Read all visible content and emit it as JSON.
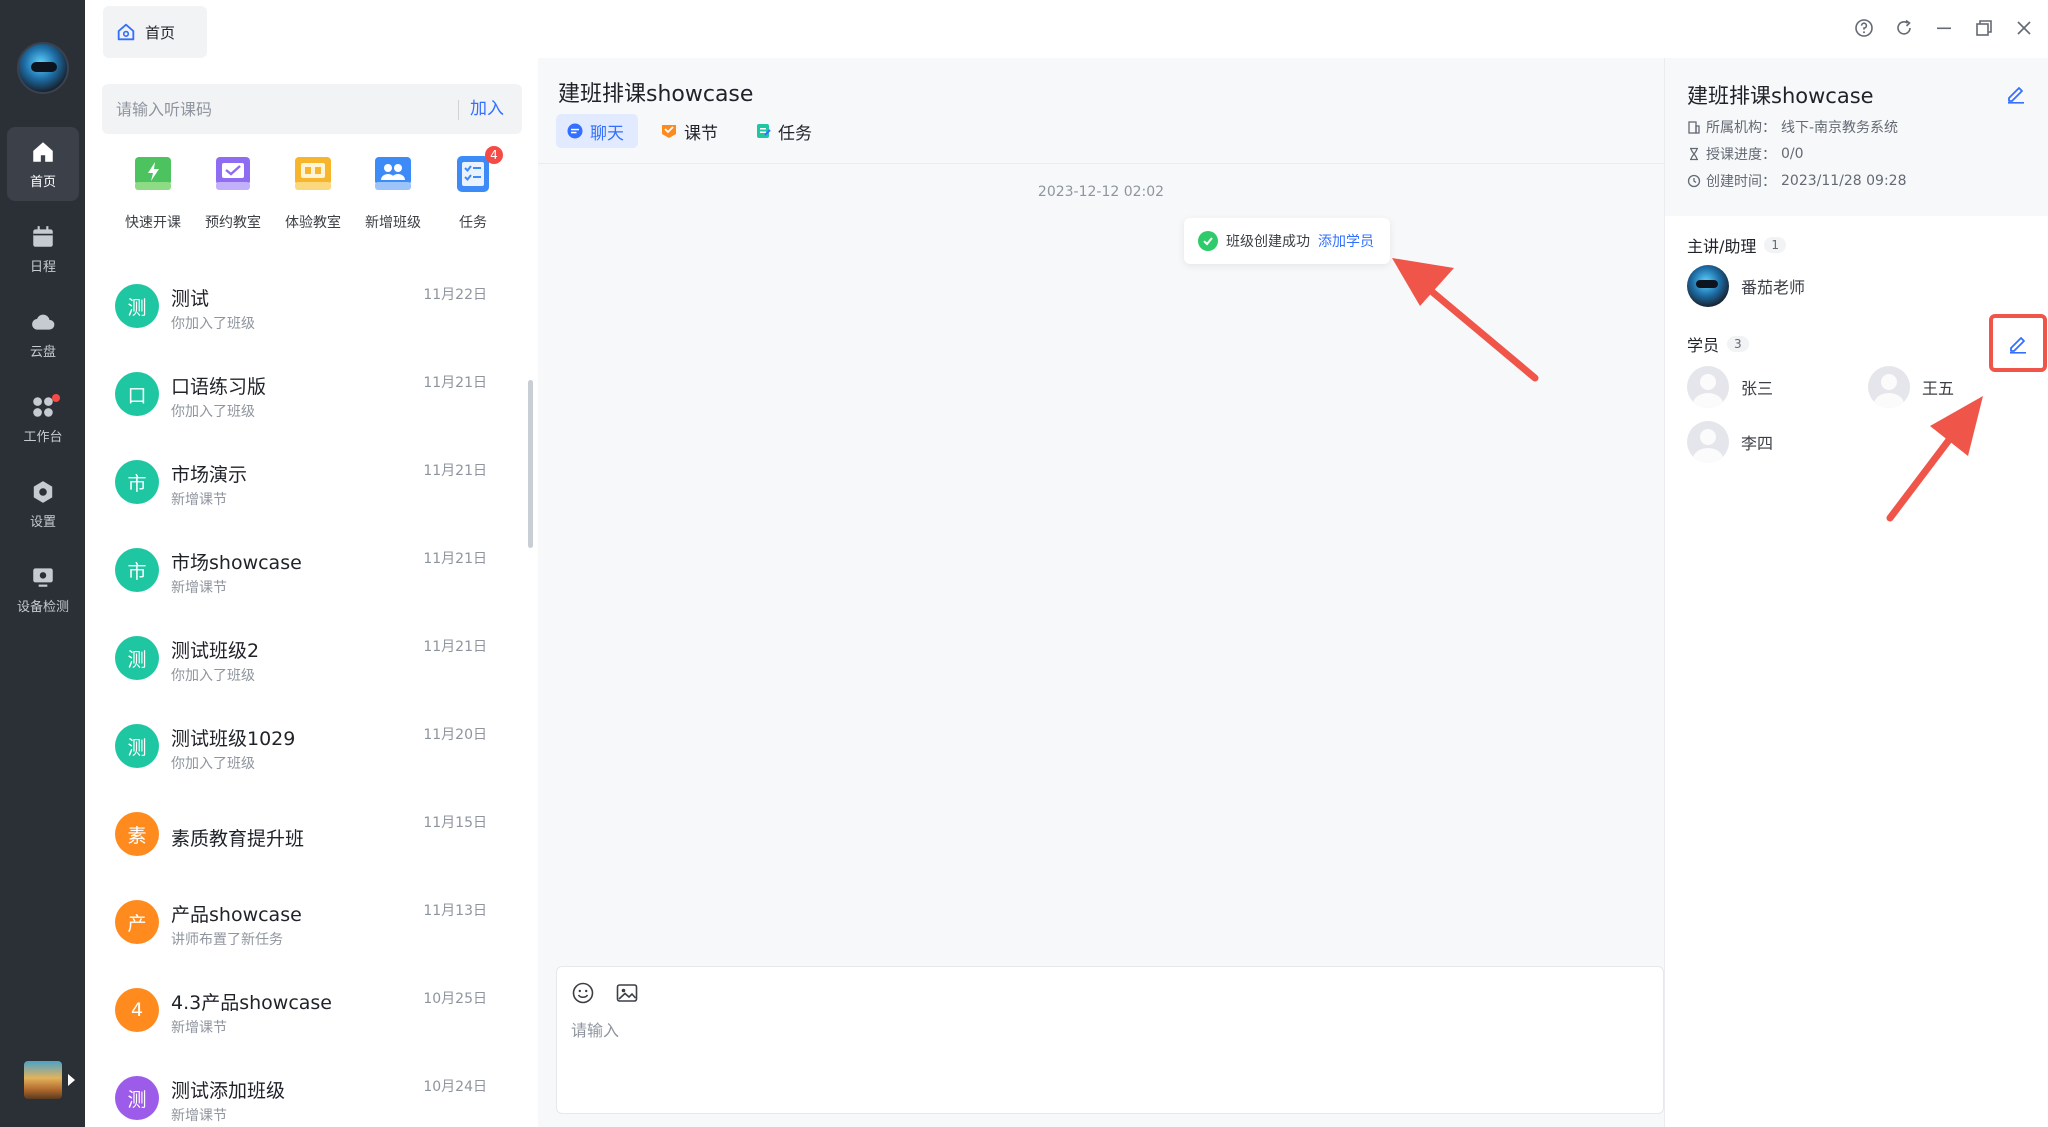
{
  "rail": {
    "items": [
      {
        "label": "首页",
        "icon": "home-icon"
      },
      {
        "label": "日程",
        "icon": "calendar-icon"
      },
      {
        "label": "云盘",
        "icon": "cloud-icon"
      },
      {
        "label": "工作台",
        "icon": "workspace-icon"
      },
      {
        "label": "设置",
        "icon": "settings-icon"
      },
      {
        "label": "设备检测",
        "icon": "device-check-icon"
      }
    ]
  },
  "top_tab": {
    "label": "首页"
  },
  "search": {
    "placeholder": "请输入听课码",
    "join_label": "加入"
  },
  "quick_actions": [
    {
      "label": "快速开课",
      "icon": "quick-start-icon",
      "color": "#4cc35f"
    },
    {
      "label": "预约教室",
      "icon": "book-room-icon",
      "color": "#8f6df2"
    },
    {
      "label": "体验教室",
      "icon": "trial-room-icon",
      "color": "#f7b52c"
    },
    {
      "label": "新增班级",
      "icon": "new-class-icon",
      "color": "#3d8bf7"
    },
    {
      "label": "任务",
      "icon": "task-icon",
      "color": "#3d8bf7",
      "badge": "4"
    }
  ],
  "classes": [
    {
      "avatar": "测",
      "name": "测试",
      "sub": "你加入了班级",
      "date": "11月22日",
      "color": "#1ec7a1"
    },
    {
      "avatar": "口",
      "name": "口语练习版",
      "sub": "你加入了班级",
      "date": "11月21日",
      "color": "#1ec7a1"
    },
    {
      "avatar": "市",
      "name": "市场演示",
      "sub": "新增课节",
      "date": "11月21日",
      "color": "#1ec7a1"
    },
    {
      "avatar": "市",
      "name": "市场showcase",
      "sub": "新增课节",
      "date": "11月21日",
      "color": "#1ec7a1"
    },
    {
      "avatar": "测",
      "name": "测试班级2",
      "sub": "你加入了班级",
      "date": "11月21日",
      "color": "#1ec7a1"
    },
    {
      "avatar": "测",
      "name": "测试班级1029",
      "sub": "你加入了班级",
      "date": "11月20日",
      "color": "#1ec7a1"
    },
    {
      "avatar": "素",
      "name": "素质教育提升班",
      "sub": "",
      "date": "11月15日",
      "color": "#ff8b1f"
    },
    {
      "avatar": "产",
      "name": "产品showcase",
      "sub": "讲师布置了新任务",
      "date": "11月13日",
      "color": "#ff8b1f"
    },
    {
      "avatar": "4",
      "name": "4.3产品showcase",
      "sub": "新增课节",
      "date": "10月25日",
      "color": "#ff8b1f"
    },
    {
      "avatar": "测",
      "name": "测试添加班级",
      "sub": "新增课节",
      "date": "10月24日",
      "color": "#9c5be8"
    }
  ],
  "chat": {
    "title": "建班排课showcase",
    "tabs": [
      {
        "label": "聊天",
        "icon": "chat-icon"
      },
      {
        "label": "课节",
        "icon": "lesson-icon"
      },
      {
        "label": "任务",
        "icon": "task-doc-icon"
      }
    ],
    "timestamp": "2023-12-12 02:02",
    "toast": {
      "text": "班级创建成功",
      "link": "添加学员"
    },
    "composer_placeholder": "请输入"
  },
  "info": {
    "title": "建班排课showcase",
    "meta": [
      {
        "label": "所属机构：",
        "value": "线下-南京教务系统",
        "icon": "building-icon"
      },
      {
        "label": "授课进度：",
        "value": "0/0",
        "icon": "hourglass-icon"
      },
      {
        "label": "创建时间：",
        "value": "2023/11/28 09:28",
        "icon": "clock-icon"
      }
    ],
    "teachers_title": "主讲/助理",
    "teachers_count": "1",
    "teachers": [
      {
        "name": "番茄老师"
      }
    ],
    "students_title": "学员",
    "students_count": "3",
    "students": [
      {
        "name": "张三"
      },
      {
        "name": "王五"
      },
      {
        "name": "李四"
      }
    ]
  },
  "colors": {
    "accent": "#3370ff",
    "highlight": "#f0554a",
    "rail_bg": "#2b2f36"
  }
}
